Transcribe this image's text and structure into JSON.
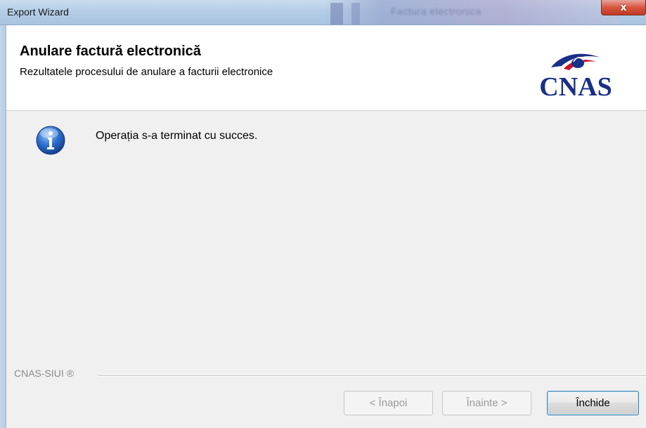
{
  "window": {
    "title": "Export Wizard",
    "close_glyph": "x",
    "background_window_title": "Factura electronica"
  },
  "header": {
    "title": "Anulare factură electronică",
    "subtitle": "Rezultatele procesului de anulare a facturii electronice",
    "logo_text": "CNAS"
  },
  "content": {
    "icon": "info-icon",
    "message": "Operația s-a terminat cu succes."
  },
  "footer": {
    "label": "CNAS-SIUI ®"
  },
  "buttons": {
    "back": "< Înapoi",
    "next": "Înainte >",
    "close": "Închide"
  },
  "colors": {
    "logo_blue": "#1a2f86",
    "logo_red": "#c8102e",
    "info_icon_blue": "#1f5bb5",
    "focus_border": "#3c7fb1"
  }
}
